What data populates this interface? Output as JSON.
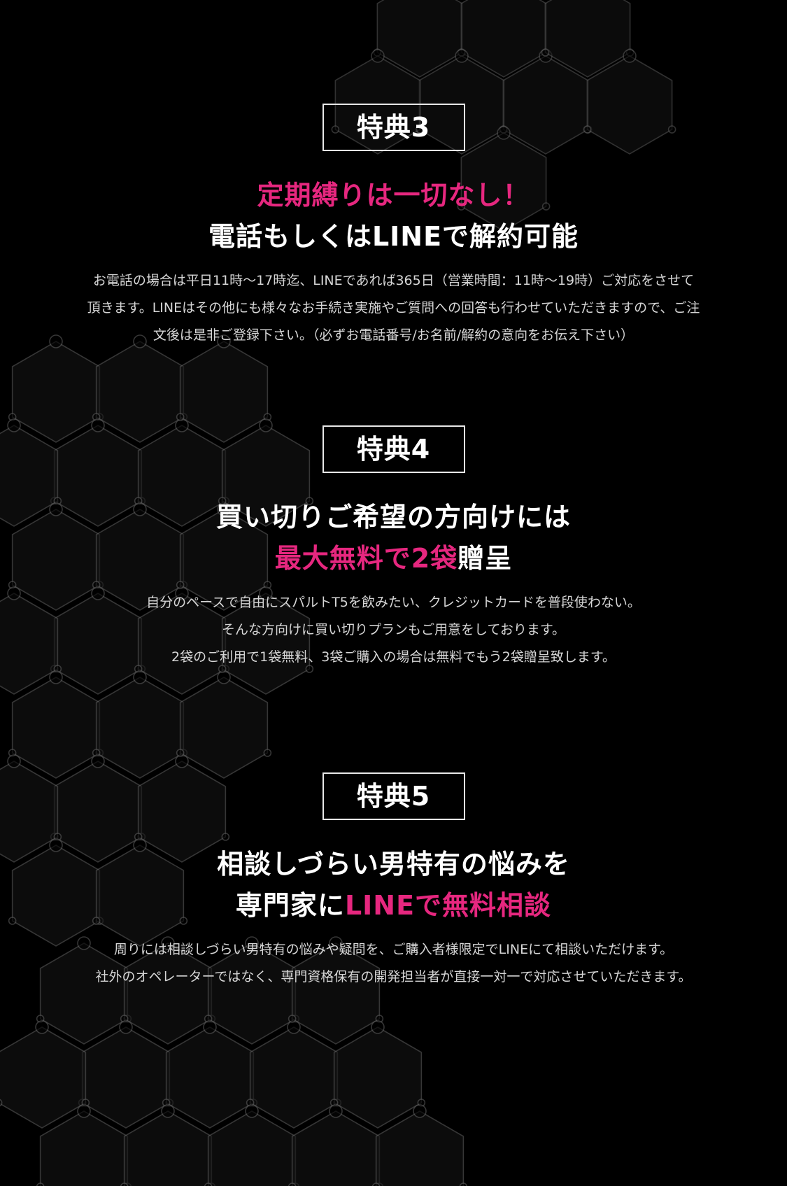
{
  "colors": {
    "background": "#000000",
    "accent_pink": "#e6277f",
    "text": "#ffffff",
    "body_text": "#d6d6d6",
    "hex_lines": "#5a5a5a"
  },
  "background_pattern": "hexagon-network",
  "sections": [
    {
      "badge": "特典3",
      "heading_lines": [
        {
          "pink": "定期縛りは一切なし！",
          "white": ""
        },
        {
          "white": "電話もしくはLINEで解約可能",
          "pink": ""
        }
      ],
      "body_lines": [
        "お電話の場合は平日11時〜17時迄、LINEであれば365日（営業時間：11時〜19時）ご対応をさせて",
        "頂きます。LINEはその他にも様々なお手続き実施やご質問への回答も行わせていただきますので、ご注",
        "文後は是非ご登録下さい。（必ずお電話番号/お名前/解約の意向をお伝え下さい）"
      ]
    },
    {
      "badge": "特典4",
      "heading_lines": [
        {
          "white": "買い切りご希望の方向けには",
          "pink": ""
        },
        {
          "pink": "最大無料で2袋",
          "white": "贈呈"
        }
      ],
      "body_lines": [
        "自分のペースで自由にスパルトT5を飲みたい、クレジットカードを普段使わない。",
        "そんな方向けに買い切りプランもご用意をしております。",
        "2袋のご利用で1袋無料、3袋ご購入の場合は無料でもう2袋贈呈致します。"
      ]
    },
    {
      "badge": "特典5",
      "heading_lines": [
        {
          "white": "相談しづらい男特有の悩みを",
          "pink": ""
        },
        {
          "white": "専門家に",
          "pink": "LINEで無料相談"
        }
      ],
      "body_lines": [
        "周りには相談しづらい男特有の悩みや疑問を、ご購入者様限定でLINEにて相談いただけます。",
        "社外のオペレーターではなく、専門資格保有の開発担当者が直接一対一で対応させていただきます。"
      ]
    }
  ]
}
